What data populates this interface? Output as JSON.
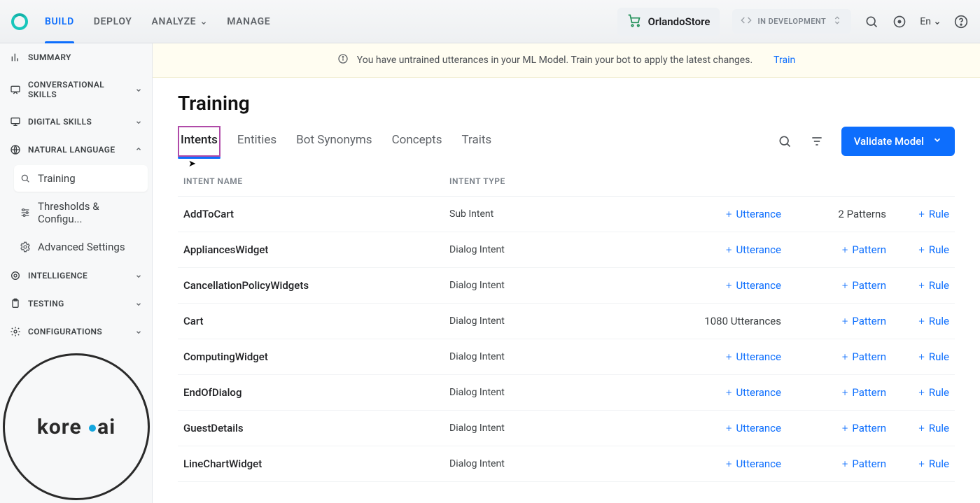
{
  "topnav": {
    "items": [
      "BUILD",
      "DEPLOY",
      "ANALYZE",
      "MANAGE"
    ],
    "active": 0
  },
  "store": {
    "name": "OrlandoStore"
  },
  "status_chip": "IN DEVELOPMENT",
  "lang": "En",
  "sidebar": {
    "sections": [
      {
        "label": "SUMMARY"
      },
      {
        "label": "CONVERSATIONAL SKILLS"
      },
      {
        "label": "DIGITAL SKILLS"
      },
      {
        "label": "NATURAL LANGUAGE",
        "expanded": true,
        "children": [
          "Training",
          "Thresholds & Configu...",
          "Advanced Settings"
        ],
        "active_child": 0
      },
      {
        "label": "INTELLIGENCE"
      },
      {
        "label": "TESTING"
      },
      {
        "label": "CONFIGURATIONS"
      }
    ]
  },
  "brand": {
    "text_a": "kore",
    "text_b": "ai"
  },
  "banner": {
    "text": "You have untrained utterances in your ML Model. Train your bot to apply the latest changes.",
    "action": "Train"
  },
  "page": {
    "title": "Training",
    "tabs": [
      "Intents",
      "Entities",
      "Bot Synonyms",
      "Concepts",
      "Traits"
    ],
    "active_tab": 0,
    "validate_button": "Validate Model"
  },
  "table": {
    "headers": {
      "name": "INTENT NAME",
      "type": "INTENT TYPE"
    },
    "rows": [
      {
        "name": "AddToCart",
        "type": "Sub Intent",
        "utter": "Utterance",
        "utter_link": true,
        "pattern": "2 Patterns",
        "pattern_link": false,
        "rule": "Rule"
      },
      {
        "name": "AppliancesWidget",
        "type": "Dialog Intent",
        "utter": "Utterance",
        "utter_link": true,
        "pattern": "Pattern",
        "pattern_link": true,
        "rule": "Rule"
      },
      {
        "name": "CancellationPolicyWidgets",
        "type": "Dialog Intent",
        "utter": "Utterance",
        "utter_link": true,
        "pattern": "Pattern",
        "pattern_link": true,
        "rule": "Rule"
      },
      {
        "name": "Cart",
        "type": "Dialog Intent",
        "utter": "1080 Utterances",
        "utter_link": false,
        "pattern": "Pattern",
        "pattern_link": true,
        "rule": "Rule"
      },
      {
        "name": "ComputingWidget",
        "type": "Dialog Intent",
        "utter": "Utterance",
        "utter_link": true,
        "pattern": "Pattern",
        "pattern_link": true,
        "rule": "Rule"
      },
      {
        "name": "EndOfDialog",
        "type": "Dialog Intent",
        "utter": "Utterance",
        "utter_link": true,
        "pattern": "Pattern",
        "pattern_link": true,
        "rule": "Rule"
      },
      {
        "name": "GuestDetails",
        "type": "Dialog Intent",
        "utter": "Utterance",
        "utter_link": true,
        "pattern": "Pattern",
        "pattern_link": true,
        "rule": "Rule"
      },
      {
        "name": "LineChartWidget",
        "type": "Dialog Intent",
        "utter": "Utterance",
        "utter_link": true,
        "pattern": "Pattern",
        "pattern_link": true,
        "rule": "Rule"
      }
    ]
  }
}
